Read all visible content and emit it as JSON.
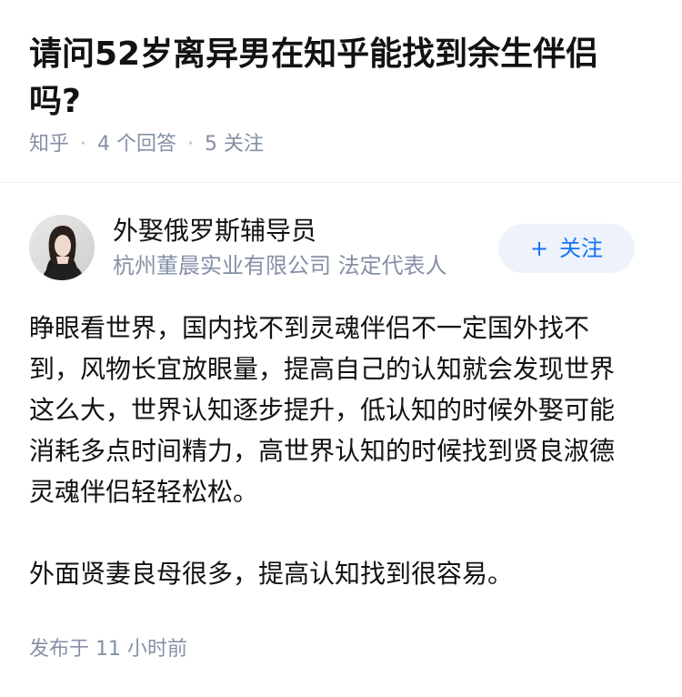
{
  "question": {
    "title": "请问52岁离异男在知乎能找到余生伴侣吗?",
    "source": "知乎",
    "answer_count": "4 个回答",
    "follower_count": "5 关注"
  },
  "answer": {
    "author_name": "外娶俄罗斯辅导员",
    "author_headline": "杭州董晨实业有限公司 法定代表人",
    "follow_label": "关注",
    "follow_icon": "plus-icon",
    "paragraphs": [
      "睁眼看世界，国内找不到灵魂伴侣不一定国外找不到，风物长宜放眼量，提高自己的认知就会发现世界这么大，世界认知逐步提升，低认知的时候外娶可能消耗多点时间精力，高世界认知的时候找到贤良淑德灵魂伴侣轻轻松松。",
      "外面贤妻良母很多，提高认知找到很容易。"
    ],
    "publish_time": "发布于 11 小时前"
  },
  "colors": {
    "accent": "#1772f6",
    "follow_bg": "#eef3fb",
    "meta_text": "#8590a6"
  }
}
